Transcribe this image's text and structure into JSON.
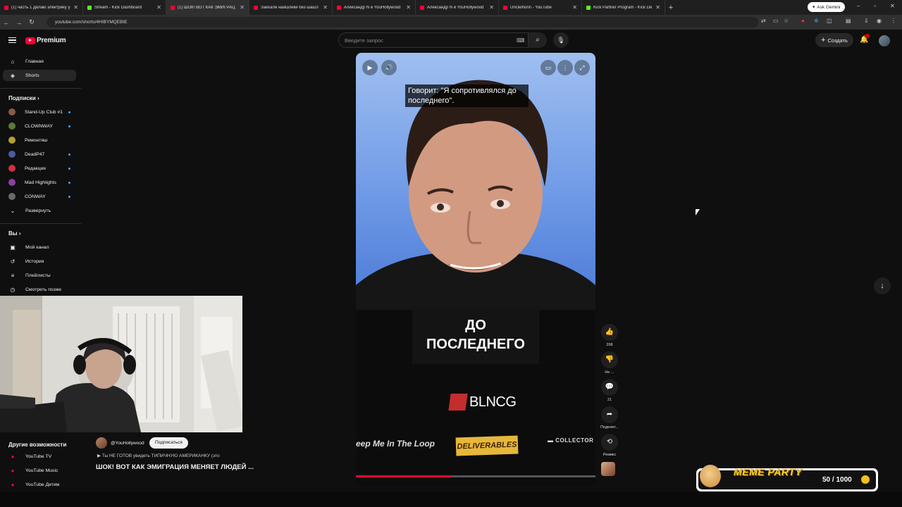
{
  "browser": {
    "tabs": [
      {
        "title": "(1) часть 1 Делаю электрику у",
        "color": "#ff0033"
      },
      {
        "title": "Stream - Kick Dashboard",
        "color": "#53fc18"
      },
      {
        "title": "(1) ШОК! ВОТ КАК ЭМИГРАЦ",
        "color": "#ff0033"
      },
      {
        "title": "Заехали наишлики без шашл",
        "color": "#ff0033"
      },
      {
        "title": "Александр N и YouHollywood",
        "color": "#ff0033"
      },
      {
        "title": "Александр N и YouHollywood",
        "color": "#ff0033"
      },
      {
        "title": "Uncleihonn - YouTube",
        "color": "#ff0033"
      },
      {
        "title": "Kick Partner Program - Kick De",
        "color": "#53fc18"
      }
    ],
    "new_tab": "+",
    "gemini": "Ask Gemini",
    "url": "youtube.com/shorts/4HIBYMQEBtE"
  },
  "header": {
    "logo": "Premium",
    "search_placeholder": "Введите запрос",
    "create": "Создать"
  },
  "sidebar": {
    "main": [
      {
        "label": "Главная",
        "icon": "⌂"
      },
      {
        "label": "Shorts",
        "icon": "◈"
      }
    ],
    "subs_heading": "Подписки",
    "subs": [
      {
        "label": "Stand-Up Club #1",
        "color": "#8a5a4a",
        "dot": true
      },
      {
        "label": "CLOWNWAY",
        "color": "#5c7a3a",
        "dot": true
      },
      {
        "label": "Ремонтяш",
        "color": "#b8a030",
        "dot": false
      },
      {
        "label": "DeadP47",
        "color": "#4a5ca0",
        "dot": true
      },
      {
        "label": "Редакция",
        "color": "#d03040",
        "dot": true
      },
      {
        "label": "Mad Highlights",
        "color": "#8a40a0",
        "dot": true
      },
      {
        "label": "CONWAY",
        "color": "#6a6a6a",
        "dot": true
      }
    ],
    "expand": "Развернуть",
    "you_heading": "Вы",
    "you": [
      {
        "label": "Мой канал",
        "icon": "▣"
      },
      {
        "label": "История",
        "icon": "↺"
      },
      {
        "label": "Плейлисты",
        "icon": "≡"
      },
      {
        "label": "Смотреть позже",
        "icon": "◷"
      }
    ],
    "more_heading": "Другие возможности",
    "more": [
      {
        "label": "YouTube TV"
      },
      {
        "label": "YouTube Music"
      },
      {
        "label": "YouTube Детям"
      }
    ]
  },
  "short": {
    "caption": "Говорит: \"Я сопротивлялся до последнего\".",
    "big_subtitle_1": "ДО",
    "big_subtitle_2": "ПОСЛЕДНЕГО",
    "brand": "BLNCG",
    "keep": "eep Me In The Loop",
    "deliverables": "DELIVERABLES",
    "collector": "COLLECTOR",
    "progress": 0.4
  },
  "actions": {
    "like_count": "208",
    "dislike_label": "Не ...",
    "comments_count": "21",
    "share_label": "Поделит...",
    "remix_label": "Ремикс"
  },
  "video": {
    "channel": "@YouHollywood",
    "subscribe": "Подписаться",
    "description": "Ты НЕ ГОТОВ увидеть ТИПИЧНУЮ АМЕРИКАНКУ (это",
    "title": "ШОК! ВОТ КАК ЭМИГРАЦИЯ МЕНЯЕТ ЛЮДЕЙ ..."
  },
  "overlay": {
    "title": "MEME PARTY",
    "counter": "50 / 1000"
  }
}
